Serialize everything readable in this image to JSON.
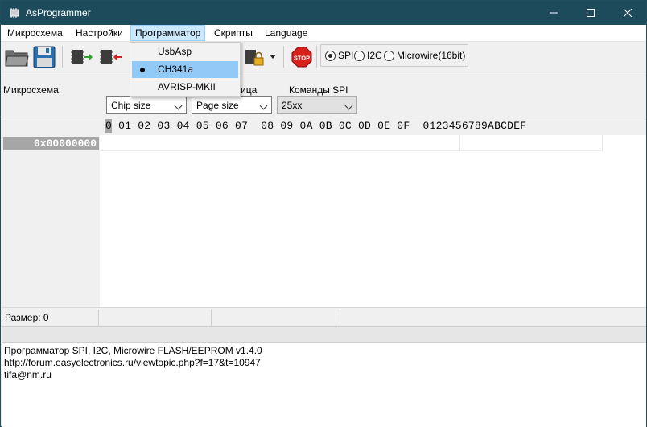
{
  "window": {
    "title": "AsProgrammer",
    "controls": {
      "minimize": "minimize-icon",
      "maximize": "maximize-icon",
      "close": "close-icon"
    }
  },
  "menu": {
    "items": [
      {
        "label": "Микросхема"
      },
      {
        "label": "Настройки"
      },
      {
        "label": "Программатор"
      },
      {
        "label": "Скрипты"
      },
      {
        "label": "Language"
      }
    ],
    "open": {
      "items": [
        {
          "label": "UsbAsp",
          "selected": false
        },
        {
          "label": "CH341a",
          "selected": true
        },
        {
          "label": "AVRISP-MKII",
          "selected": false
        }
      ]
    }
  },
  "toolbar": {
    "radios": [
      {
        "label": "SPI",
        "checked": true
      },
      {
        "label": "I2C",
        "checked": false
      },
      {
        "label": "Microwire(16bit)",
        "checked": false
      }
    ]
  },
  "settings": {
    "chip_label": "Микросхема:",
    "page_label_partial": "ица",
    "spi_commands_label": "Команды SPI",
    "chip_size": "Chip size",
    "page_size": "Page size",
    "spi_commands": "25xx"
  },
  "hex": {
    "cursor_char": "0",
    "header": "0 01 02 03 04 05 06 07  08 09 0A 0B 0C 0D 0E 0F  0123456789ABCDEF",
    "rows": [
      {
        "address": "0x00000000"
      }
    ]
  },
  "status": {
    "size": "Размер: 0"
  },
  "log": {
    "lines": [
      "Программатор SPI, I2C, Microwire FLASH/EEPROM v1.4.0",
      "http://forum.easyelectronics.ru/viewtopic.php?f=17&t=10947",
      "tifa@nm.ru"
    ]
  },
  "colors": {
    "titlebar": "#1e4b5c",
    "menu_highlight": "#cce8ff",
    "dropdown_selected": "#91c9f7",
    "stop_red": "#d9211c"
  }
}
